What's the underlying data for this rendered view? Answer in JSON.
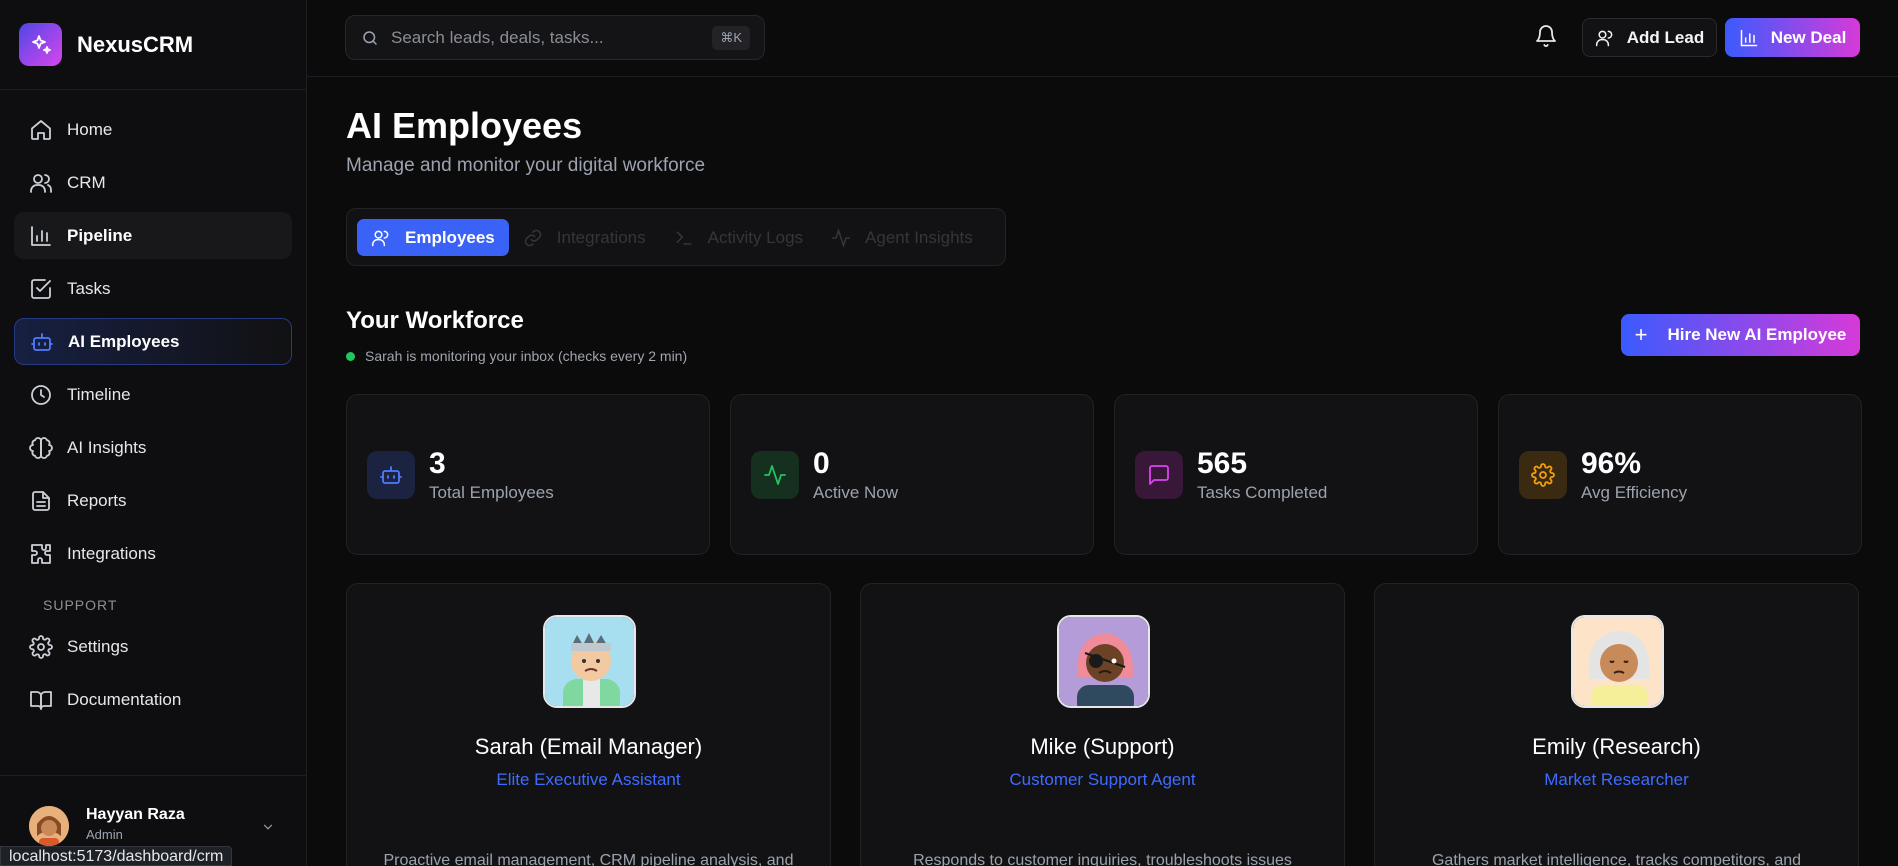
{
  "brand": {
    "name": "NexusCRM"
  },
  "sidebar": {
    "items": [
      {
        "label": "Home"
      },
      {
        "label": "CRM"
      },
      {
        "label": "Pipeline"
      },
      {
        "label": "Tasks"
      },
      {
        "label": "AI Employees"
      },
      {
        "label": "Timeline"
      },
      {
        "label": "AI Insights"
      },
      {
        "label": "Reports"
      },
      {
        "label": "Integrations"
      }
    ],
    "support_label": "SUPPORT",
    "support_items": [
      {
        "label": "Settings"
      },
      {
        "label": "Documentation"
      }
    ],
    "user": {
      "name": "Hayyan Raza",
      "role": "Admin"
    }
  },
  "status_bar": {
    "url": "localhost:5173/dashboard/crm"
  },
  "topbar": {
    "search_placeholder": "Search leads, deals, tasks...",
    "shortcut": "⌘K",
    "add_lead_label": "Add Lead",
    "new_deal_label": "New Deal"
  },
  "page": {
    "title": "AI Employees",
    "subtitle": "Manage and monitor your digital workforce"
  },
  "tabs": [
    {
      "label": "Employees"
    },
    {
      "label": "Integrations"
    },
    {
      "label": "Activity Logs"
    },
    {
      "label": "Agent Insights"
    }
  ],
  "workforce": {
    "title": "Your Workforce",
    "status": "Sarah is monitoring your inbox (checks every 2 min)",
    "hire_label": "Hire New AI Employee"
  },
  "stats": [
    {
      "value": "3",
      "label": "Total Employees",
      "icon": "bot-icon",
      "color": "#4f7bff"
    },
    {
      "value": "0",
      "label": "Active Now",
      "icon": "activity-icon",
      "color": "#22c55e"
    },
    {
      "value": "565",
      "label": "Tasks Completed",
      "icon": "message-icon",
      "color": "#d946ef"
    },
    {
      "value": "96%",
      "label": "Avg Efficiency",
      "icon": "gear-icon",
      "color": "#f59e0b"
    }
  ],
  "employees": [
    {
      "name": "Sarah (Email Manager)",
      "role": "Elite Executive Assistant",
      "description": "Proactive email management, CRM pipeline analysis, and"
    },
    {
      "name": "Mike (Support)",
      "role": "Customer Support Agent",
      "description": "Responds to customer inquiries, troubleshoots issues"
    },
    {
      "name": "Emily (Research)",
      "role": "Market Researcher",
      "description": "Gathers market intelligence, tracks competitors, and"
    }
  ]
}
